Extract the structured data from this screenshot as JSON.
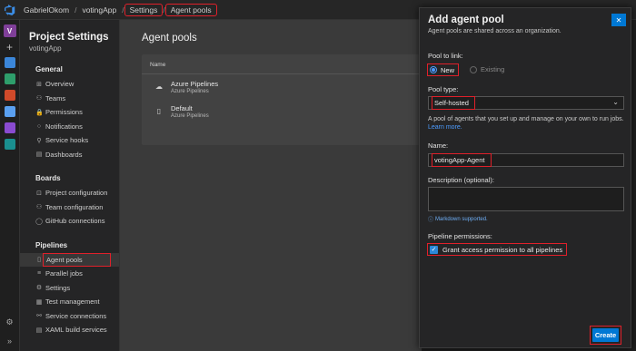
{
  "breadcrumb": {
    "org": "GabrielOkom",
    "project": "votingApp",
    "settings": "Settings",
    "agent_pools": "Agent pools",
    "separator": "/"
  },
  "rail": {
    "org_initial": "V",
    "plus": "+",
    "gear": "⚙",
    "expand": "»",
    "colors": [
      "#3b86d8",
      "#2e9e6b",
      "#d04a2a",
      "#5aa0f0",
      "#8a4bd0",
      "#1a8f8f"
    ]
  },
  "sidebar": {
    "title": "Project Settings",
    "subtitle": "votingApp",
    "sections": [
      {
        "label": "General",
        "items": [
          {
            "label": "Overview",
            "icon": "⊞"
          },
          {
            "label": "Teams",
            "icon": "⚇"
          },
          {
            "label": "Permissions",
            "icon": "🔒"
          },
          {
            "label": "Notifications",
            "icon": "○"
          },
          {
            "label": "Service hooks",
            "icon": "⚲"
          },
          {
            "label": "Dashboards",
            "icon": "▤"
          }
        ]
      },
      {
        "label": "Boards",
        "items": [
          {
            "label": "Project configuration",
            "icon": "⊡"
          },
          {
            "label": "Team configuration",
            "icon": "⚇"
          },
          {
            "label": "GitHub connections",
            "icon": "◯"
          }
        ]
      },
      {
        "label": "Pipelines",
        "items": [
          {
            "label": "Agent pools",
            "icon": "▯",
            "active": true
          },
          {
            "label": "Parallel jobs",
            "icon": "≡"
          },
          {
            "label": "Settings",
            "icon": "⚙"
          },
          {
            "label": "Test management",
            "icon": "▦"
          },
          {
            "label": "Service connections",
            "icon": "⚯"
          },
          {
            "label": "XAML build services",
            "icon": "▤"
          }
        ]
      }
    ]
  },
  "main": {
    "title": "Agent pools",
    "column_header": "Name",
    "rows": [
      {
        "name": "Azure Pipelines",
        "sub": "Azure Pipelines",
        "icon": "☁"
      },
      {
        "name": "Default",
        "sub": "Azure Pipelines",
        "icon": "▯"
      }
    ]
  },
  "dialog": {
    "title": "Add agent pool",
    "description": "Agent pools are shared across an organization.",
    "close": "✕",
    "pool_to_link_label": "Pool to link:",
    "radio_new": "New",
    "radio_existing": "Existing",
    "pool_type_label": "Pool type:",
    "pool_type_value": "Self-hosted",
    "help_text": "A pool of agents that you set up and manage on your own to run jobs.",
    "learn_more": "Learn more.",
    "name_label": "Name:",
    "name_value": "votingApp-Agent",
    "description_label": "Description (optional):",
    "markdown_note": "Markdown supported.",
    "permissions_label": "Pipeline permissions:",
    "grant_access": "Grant access permission to all pipelines",
    "create_button": "Create"
  }
}
